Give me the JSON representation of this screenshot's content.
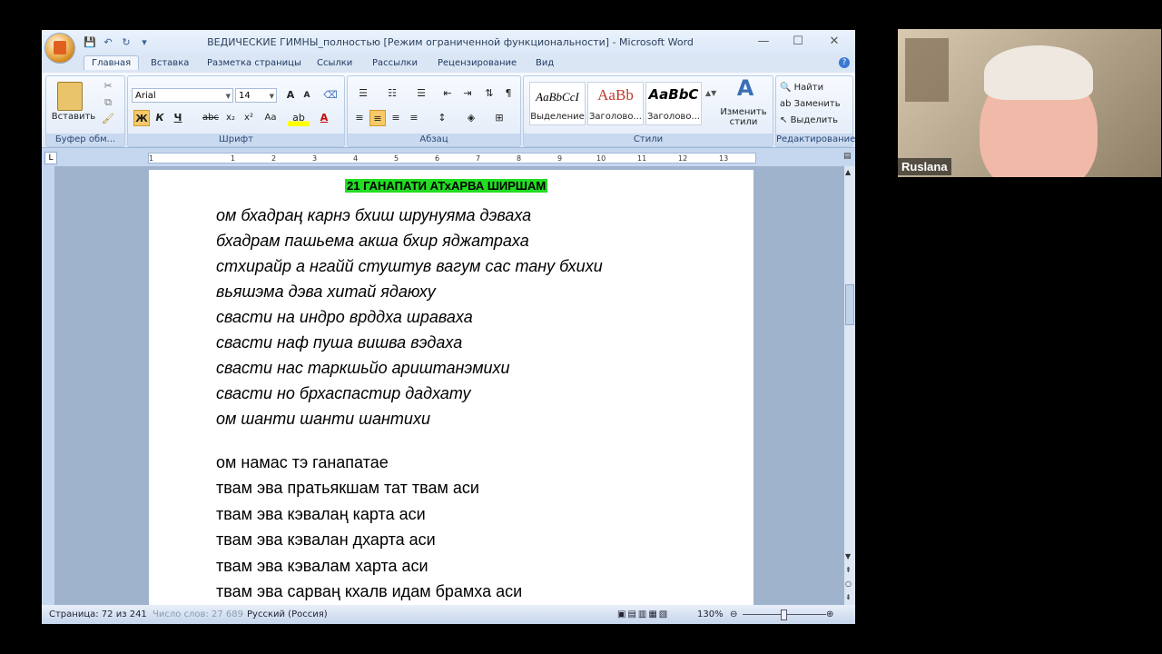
{
  "window": {
    "title": "ВЕДИЧЕСКИЕ ГИМНЫ_полностью [Режим ограниченной функциональности] - Microsoft Word",
    "controls": [
      "—",
      "☐",
      "✕"
    ]
  },
  "ribbon_tabs": [
    "Главная",
    "Вставка",
    "Разметка страницы",
    "Ссылки",
    "Рассылки",
    "Рецензирование",
    "Вид"
  ],
  "ribbon": {
    "clipboard": {
      "label": "Буфер обм...",
      "paste": "Вставить"
    },
    "font": {
      "label": "Шрифт",
      "family": "Arial",
      "size": "14",
      "bold": "Ж",
      "italic": "К",
      "underline": "Ч"
    },
    "paragraph": {
      "label": "Абзац"
    },
    "styles": {
      "label": "Стили",
      "items": [
        {
          "sample": "AaBbCcI",
          "name": "Выделение"
        },
        {
          "sample": "AaBb",
          "name": "Заголово..."
        },
        {
          "sample": "AaBbC",
          "name": "Заголово..."
        }
      ],
      "change": "Изменить стили"
    },
    "editing": {
      "label": "Редактирование",
      "find": "Найти",
      "replace": "Заменить",
      "select": "Выделить"
    }
  },
  "ruler_numbers": [
    "1",
    "1",
    "2",
    "3",
    "4",
    "5",
    "6",
    "7",
    "8",
    "9",
    "10",
    "11",
    "12",
    "13"
  ],
  "document": {
    "heading": "21  ГАНАПАТИ АТхАРВА ШИРШАМ",
    "lines": [
      "ом бхадраң карнэ бхиш шрунуяма дэваха",
      "бхадрам пашьема акша бхир яджатраха",
      "стхирайр а нгайй стуштув вагум сас тану бхихи",
      "вьяшэма дэва хитай ядаюху",
      "свасти на индро врддха шраваха",
      "свасти наф пуша вишва вэдаха",
      "свасти нас таркшьйо ариштанэмихи",
      "свасти но брхаспастир дадхату",
      "ом шанти шанти шантихи",
      "ом намас тэ ганапатае",
      "твам эва пратьякшам тат твам аси",
      "твам эва кэвалаң карта аси",
      "твам эва кэвалан дхарта аси",
      "твам эва кэвалам харта аси",
      "твам эва сарваң кхалв идам брамха аси"
    ]
  },
  "statusbar": {
    "page": "Страница: 72 из 241",
    "words": "Число слов: 27 689",
    "language": "Русский (Россия)",
    "zoom": "130%"
  },
  "video": {
    "participant": "Ruslana"
  }
}
